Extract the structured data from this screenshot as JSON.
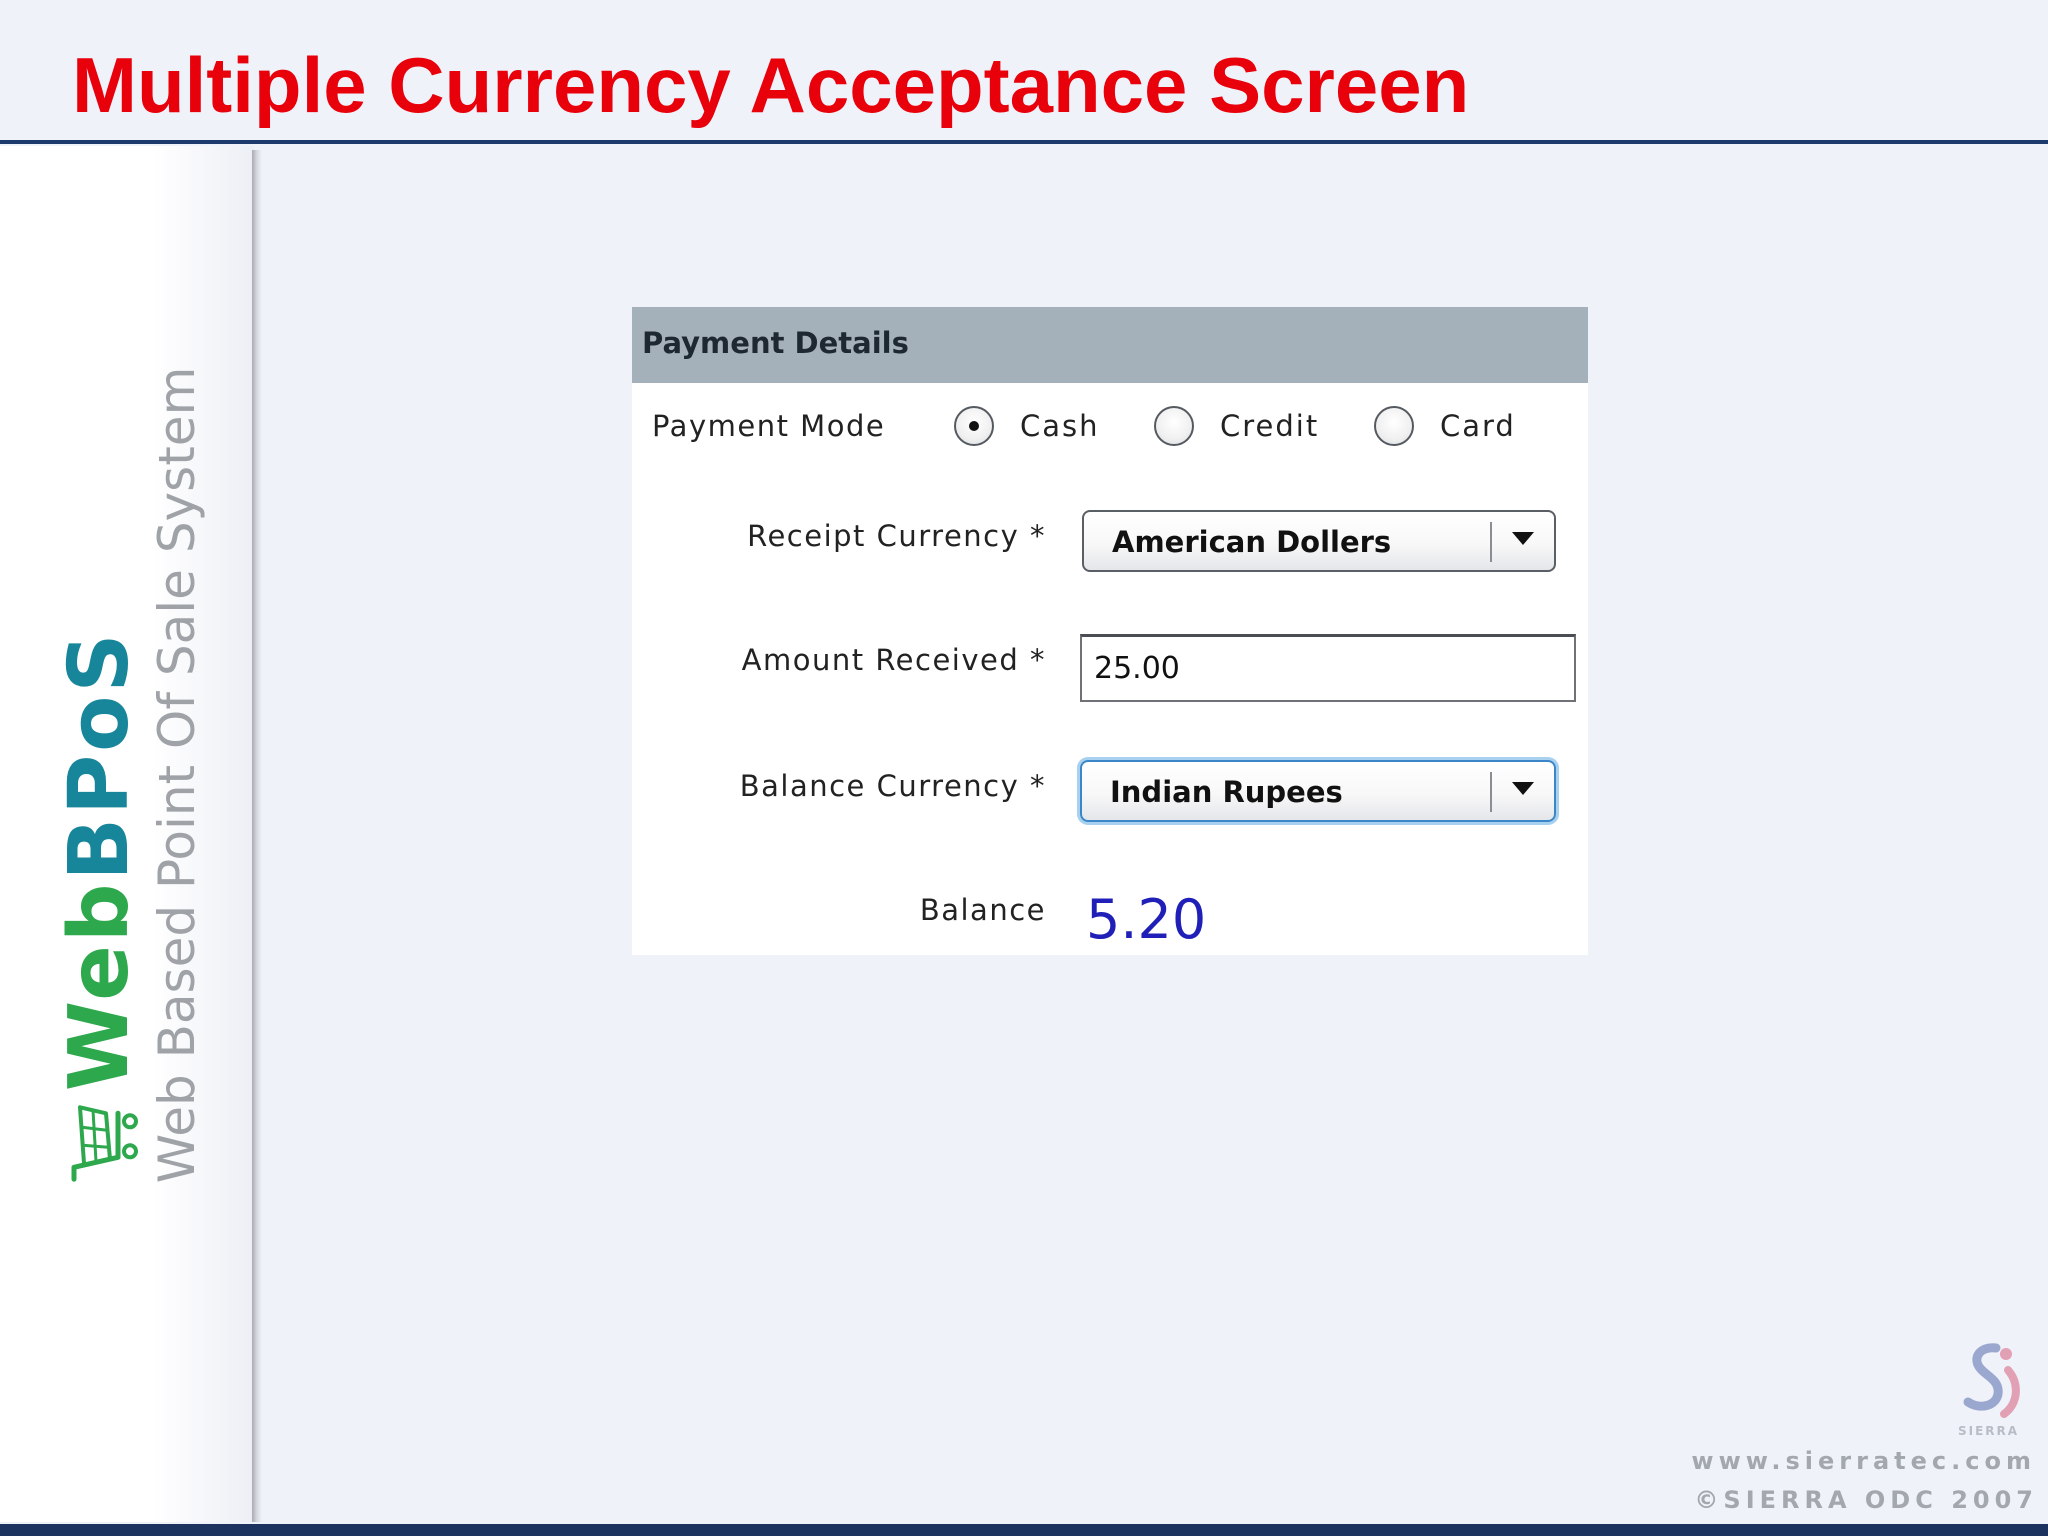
{
  "slide": {
    "title": "Multiple Currency Acceptance Screen"
  },
  "brand": {
    "name_part1": "Web",
    "name_part2": "BPoS",
    "tagline": "Web Based Point Of Sale System",
    "icon": "shopping-cart-icon"
  },
  "payment": {
    "header": "Payment Details",
    "mode_label": "Payment Mode",
    "modes": [
      {
        "label": "Cash",
        "selected": true
      },
      {
        "label": "Credit",
        "selected": false
      },
      {
        "label": "Card",
        "selected": false
      }
    ],
    "receipt_currency_label": "Receipt Currency *",
    "receipt_currency_value": "American Dollers",
    "amount_received_label": "Amount Received *",
    "amount_received_value": "25.00",
    "balance_currency_label": "Balance Currency *",
    "balance_currency_value": "Indian Rupees",
    "balance_label": "Balance",
    "balance_value": "5.20"
  },
  "footer": {
    "logo_word": "SIERRA",
    "url": "www.sierratec.com",
    "copyright": "©SIERRA ODC 2007"
  },
  "colors": {
    "title": "#e8000b",
    "rule": "#1c3a6b",
    "panel_header": "#a4b0ba",
    "balance_value": "#2020b8",
    "brand_green": "#2ea84c",
    "brand_teal": "#18869a"
  }
}
